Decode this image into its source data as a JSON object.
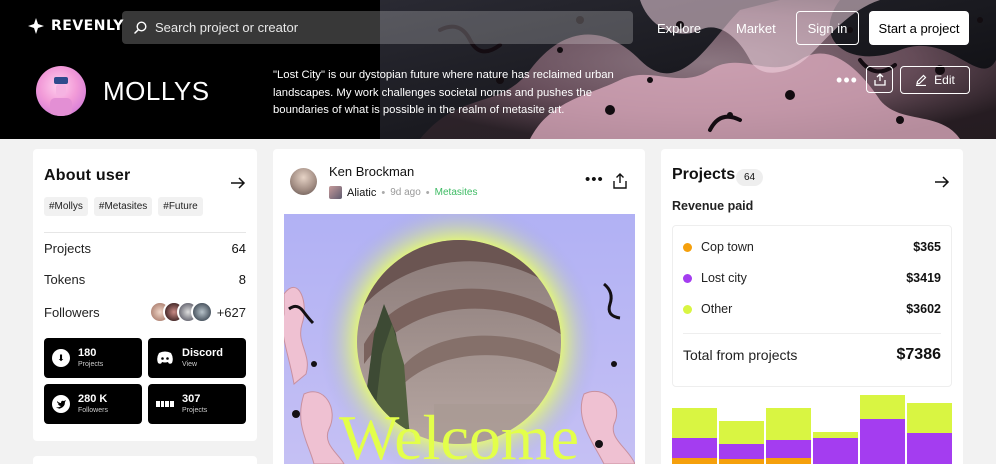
{
  "brand": {
    "name": "REVENLY"
  },
  "search": {
    "placeholder": "Search project or creator"
  },
  "nav": {
    "explore": "Explore",
    "market": "Market",
    "sign_in": "Sign in",
    "start_project": "Start a project"
  },
  "profile": {
    "username": "MOLLYS",
    "bio": "\"Lost City\" is our dystopian future where nature has reclaimed urban landscapes. My work challenges societal norms and pushes the boundaries of what is possible in the realm of metasite art.",
    "edit_label": "Edit"
  },
  "about": {
    "title": "About user",
    "tags": [
      "#Mollys",
      "#Metasites",
      "#Future"
    ],
    "stats": [
      {
        "label": "Projects",
        "value": "64"
      },
      {
        "label": "Tokens",
        "value": "8"
      }
    ],
    "followers": {
      "label": "Followers",
      "count": "+627"
    },
    "socials": [
      {
        "icon": "download-icon",
        "main": "180",
        "sub": "Projects"
      },
      {
        "icon": "discord-icon",
        "main": "Discord",
        "sub": "View"
      },
      {
        "icon": "twitter-icon",
        "main": "280 K",
        "sub": "Followers"
      },
      {
        "icon": "blur-icon",
        "main": "307",
        "sub": "Projects"
      }
    ]
  },
  "post": {
    "author": "Ken Brockman",
    "collection": "Aliatic",
    "time": "9d ago",
    "category": "Metasites",
    "image_text": "Welcome"
  },
  "projects": {
    "title": "Projects",
    "count": "64",
    "subtitle": "Revenue paid",
    "revenue": [
      {
        "label": "Cop town",
        "value": "$365",
        "color": "#f5a00c"
      },
      {
        "label": "Lost city",
        "value": "$3419",
        "color": "#a43df0"
      },
      {
        "label": "Other",
        "value": "$3602",
        "color": "#d9f542"
      }
    ],
    "total_label": "Total from projects",
    "total_value": "$7386"
  },
  "colors": {
    "accent_lime": "#d9f542",
    "accent_purple": "#a43df0",
    "accent_orange": "#f5a00c",
    "green": "#3dbb63"
  }
}
